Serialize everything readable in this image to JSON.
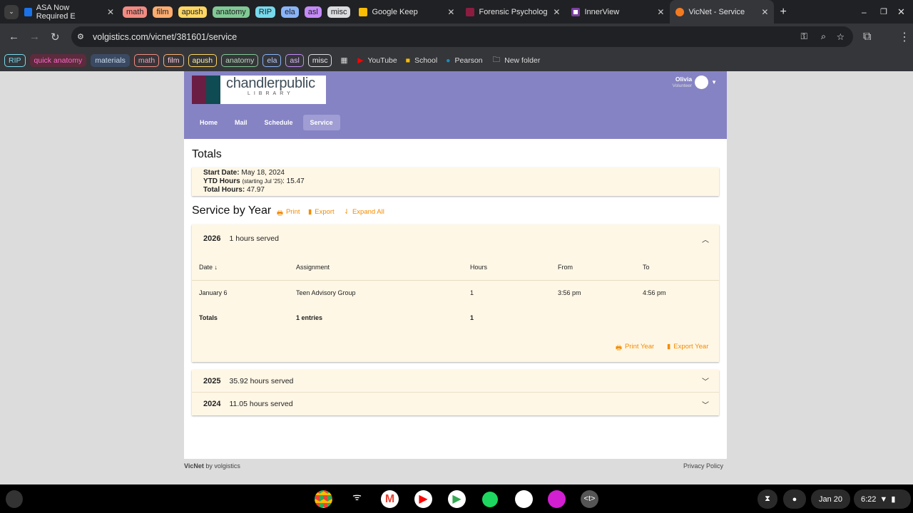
{
  "browser": {
    "tabs": [
      {
        "title": "ASA Now Required E",
        "color": "#1a73e8"
      },
      {
        "title": "Google Keep",
        "color": "#fbbc04"
      },
      {
        "title": "Forensic Psycholog",
        "color": "#8c1d40"
      },
      {
        "title": "InnerView",
        "color": "#7b3fa0"
      },
      {
        "title": "VicNet - Service",
        "color": "#f47a20"
      }
    ],
    "tab_groups": [
      {
        "label": "math",
        "color": "#f28b82"
      },
      {
        "label": "film",
        "color": "#fcad70"
      },
      {
        "label": "apush",
        "color": "#fdd663"
      },
      {
        "label": "anatomy",
        "color": "#81c995"
      },
      {
        "label": "RIP",
        "color": "#78d9ec"
      },
      {
        "label": "ela",
        "color": "#8ab4f8"
      },
      {
        "label": "asl",
        "color": "#c58af9"
      },
      {
        "label": "misc",
        "color": "#dadce0"
      }
    ],
    "url": "volgistics.com/vicnet/381601/service",
    "bookmark_chips": [
      {
        "label": "RIP",
        "color": "#78d9ec"
      },
      {
        "label": "quick anatomy",
        "color": "#5c2b3c"
      },
      {
        "label": "materials",
        "color": "#3b4a63"
      },
      {
        "label": "math",
        "color": "#f28b82"
      },
      {
        "label": "film",
        "color": "#fcad70"
      },
      {
        "label": "apush",
        "color": "#fdd663"
      },
      {
        "label": "anatomy",
        "color": "#81c995"
      },
      {
        "label": "ela",
        "color": "#8ab4f8"
      },
      {
        "label": "asl",
        "color": "#c58af9"
      },
      {
        "label": "misc",
        "color": "#dadce0"
      }
    ],
    "bookmarks": [
      "YouTube",
      "School",
      "Pearson",
      "New folder"
    ]
  },
  "site": {
    "logo_main": "chandlerpublic",
    "logo_sub": "LIBRARY",
    "user_name": "Olivia",
    "user_role": "Volunteer",
    "nav": [
      "Home",
      "Mail",
      "Schedule",
      "Service"
    ],
    "active_nav": "Service",
    "accent": "#f28c00",
    "header_color": "#8683c4"
  },
  "totals": {
    "heading": "Totals",
    "start_label": "Start Date:",
    "start": "May 18, 2024",
    "ytd_label": "YTD Hours",
    "ytd_note": "(starting Jul '25)",
    "ytd": ": 15.47",
    "total_label": "Total Hours:",
    "total": "47.97"
  },
  "service": {
    "heading": "Service by Year",
    "print": "Print",
    "export": "Export",
    "expand": "Expand All",
    "years": [
      {
        "year": "2026",
        "summary": "1 hours served",
        "expanded": true
      },
      {
        "year": "2025",
        "summary": "35.92 hours served",
        "expanded": false
      },
      {
        "year": "2024",
        "summary": "11.05 hours served",
        "expanded": false
      }
    ],
    "columns": [
      "Date",
      "Assignment",
      "Hours",
      "From",
      "To"
    ],
    "rows": [
      [
        "January 6",
        "Teen Advisory Group",
        "1",
        "3:56 pm",
        "4:56 pm"
      ]
    ],
    "totals_row": [
      "Totals",
      "1 entries",
      "1"
    ],
    "print_year": "Print Year",
    "export_year": "Export Year"
  },
  "footer": {
    "brand": "VicNet",
    "by": "by volgistics",
    "privacy": "Privacy Policy"
  },
  "tray": {
    "date": "Jan 20",
    "time": "6:22"
  }
}
